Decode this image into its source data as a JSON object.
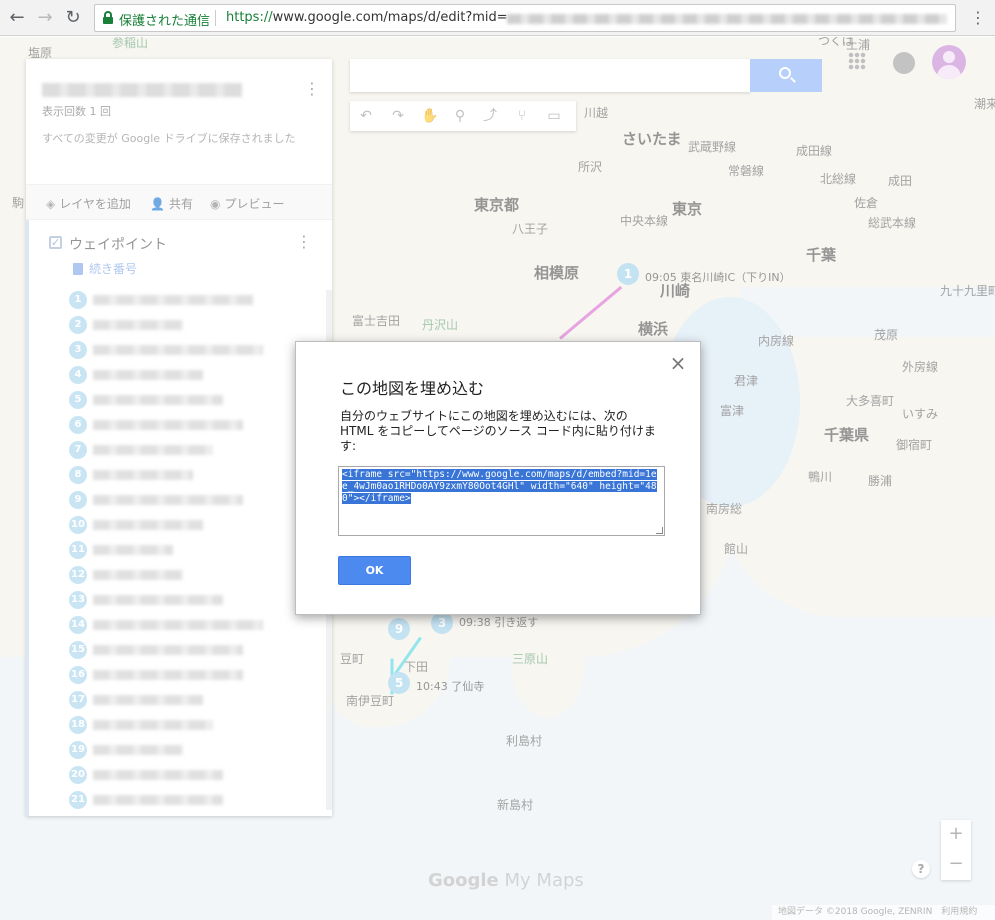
{
  "browser": {
    "secure_label": "保護された通信",
    "url_scheme": "https://",
    "url_rest": "www.google.com/maps/d/edit?mid=",
    "back_icon": "←",
    "forward_icon": "→",
    "reload_icon": "↻",
    "menu_icon": "⋮"
  },
  "map": {
    "labels": [
      "塩原",
      "参稲山",
      "つくば",
      "土浦",
      "潮来",
      "さいたま",
      "川越",
      "武蔵野線",
      "所沢",
      "成田線",
      "常磐線",
      "北総線",
      "成田",
      "東京都",
      "東京",
      "八王子",
      "中央本線",
      "佐倉",
      "千葉",
      "総武本線",
      "相模原",
      "九十九里町",
      "川崎",
      "富士吉田",
      "丹沢山",
      "横浜",
      "茂原",
      "内房線",
      "外房線",
      "君津",
      "大多喜町",
      "いすみ",
      "富津",
      "千葉県",
      "御宿町",
      "鴨川",
      "勝浦",
      "南房総",
      "館山",
      "伊豆の国",
      "三原山",
      "下田",
      "南伊豆町",
      "利島村",
      "新島村",
      "駒",
      "豆町"
    ],
    "markers": [
      {
        "num": "1",
        "label": "09:05 東名川崎IC（下りIN）"
      },
      {
        "num": "9",
        "label": ""
      },
      {
        "num": "3",
        "label": "09:38 引き返す"
      },
      {
        "num": "5",
        "label": "10:43 了仙寺"
      }
    ]
  },
  "panel": {
    "views": "表示回数 1 回",
    "saved": "すべての変更が Google ドライブに保存されました",
    "add_layer": "レイヤを追加",
    "share": "共有",
    "preview": "プレビュー",
    "layer_name": "ウェイポイント",
    "sequence": "続き番号",
    "items": [
      "1",
      "2",
      "3",
      "4",
      "5",
      "6",
      "7",
      "8",
      "9",
      "10",
      "11",
      "12",
      "13",
      "14",
      "15",
      "16",
      "17",
      "18",
      "19",
      "20",
      "21"
    ]
  },
  "tools": [
    "↶",
    "↷",
    "✋",
    "⚲",
    "⤴",
    "⑂",
    "▭"
  ],
  "top_right": {
    "apps": "apps-icon",
    "notifications": "bell-icon",
    "account": "avatar"
  },
  "zoom": {
    "in": "+",
    "out": "−"
  },
  "help": "?",
  "brand": {
    "google": "Google",
    "my_maps": " My Maps"
  },
  "footer": "地図データ ©2018 Google, ZENRIN　利用規約",
  "dialog": {
    "title": "この地図を埋め込む",
    "description": "自分のウェブサイトにこの地図を埋め込むには、次の HTML をコピーしてページのソース コード内に貼り付けます:",
    "code": "<iframe src=\"https://www.google.com/maps/d/embed?mid=1ee_4wJm0ao1RHDo0AY9zxmY80Oot4GHl\" width=\"640\" height=\"480\"></iframe>",
    "ok": "OK",
    "close": "×"
  }
}
